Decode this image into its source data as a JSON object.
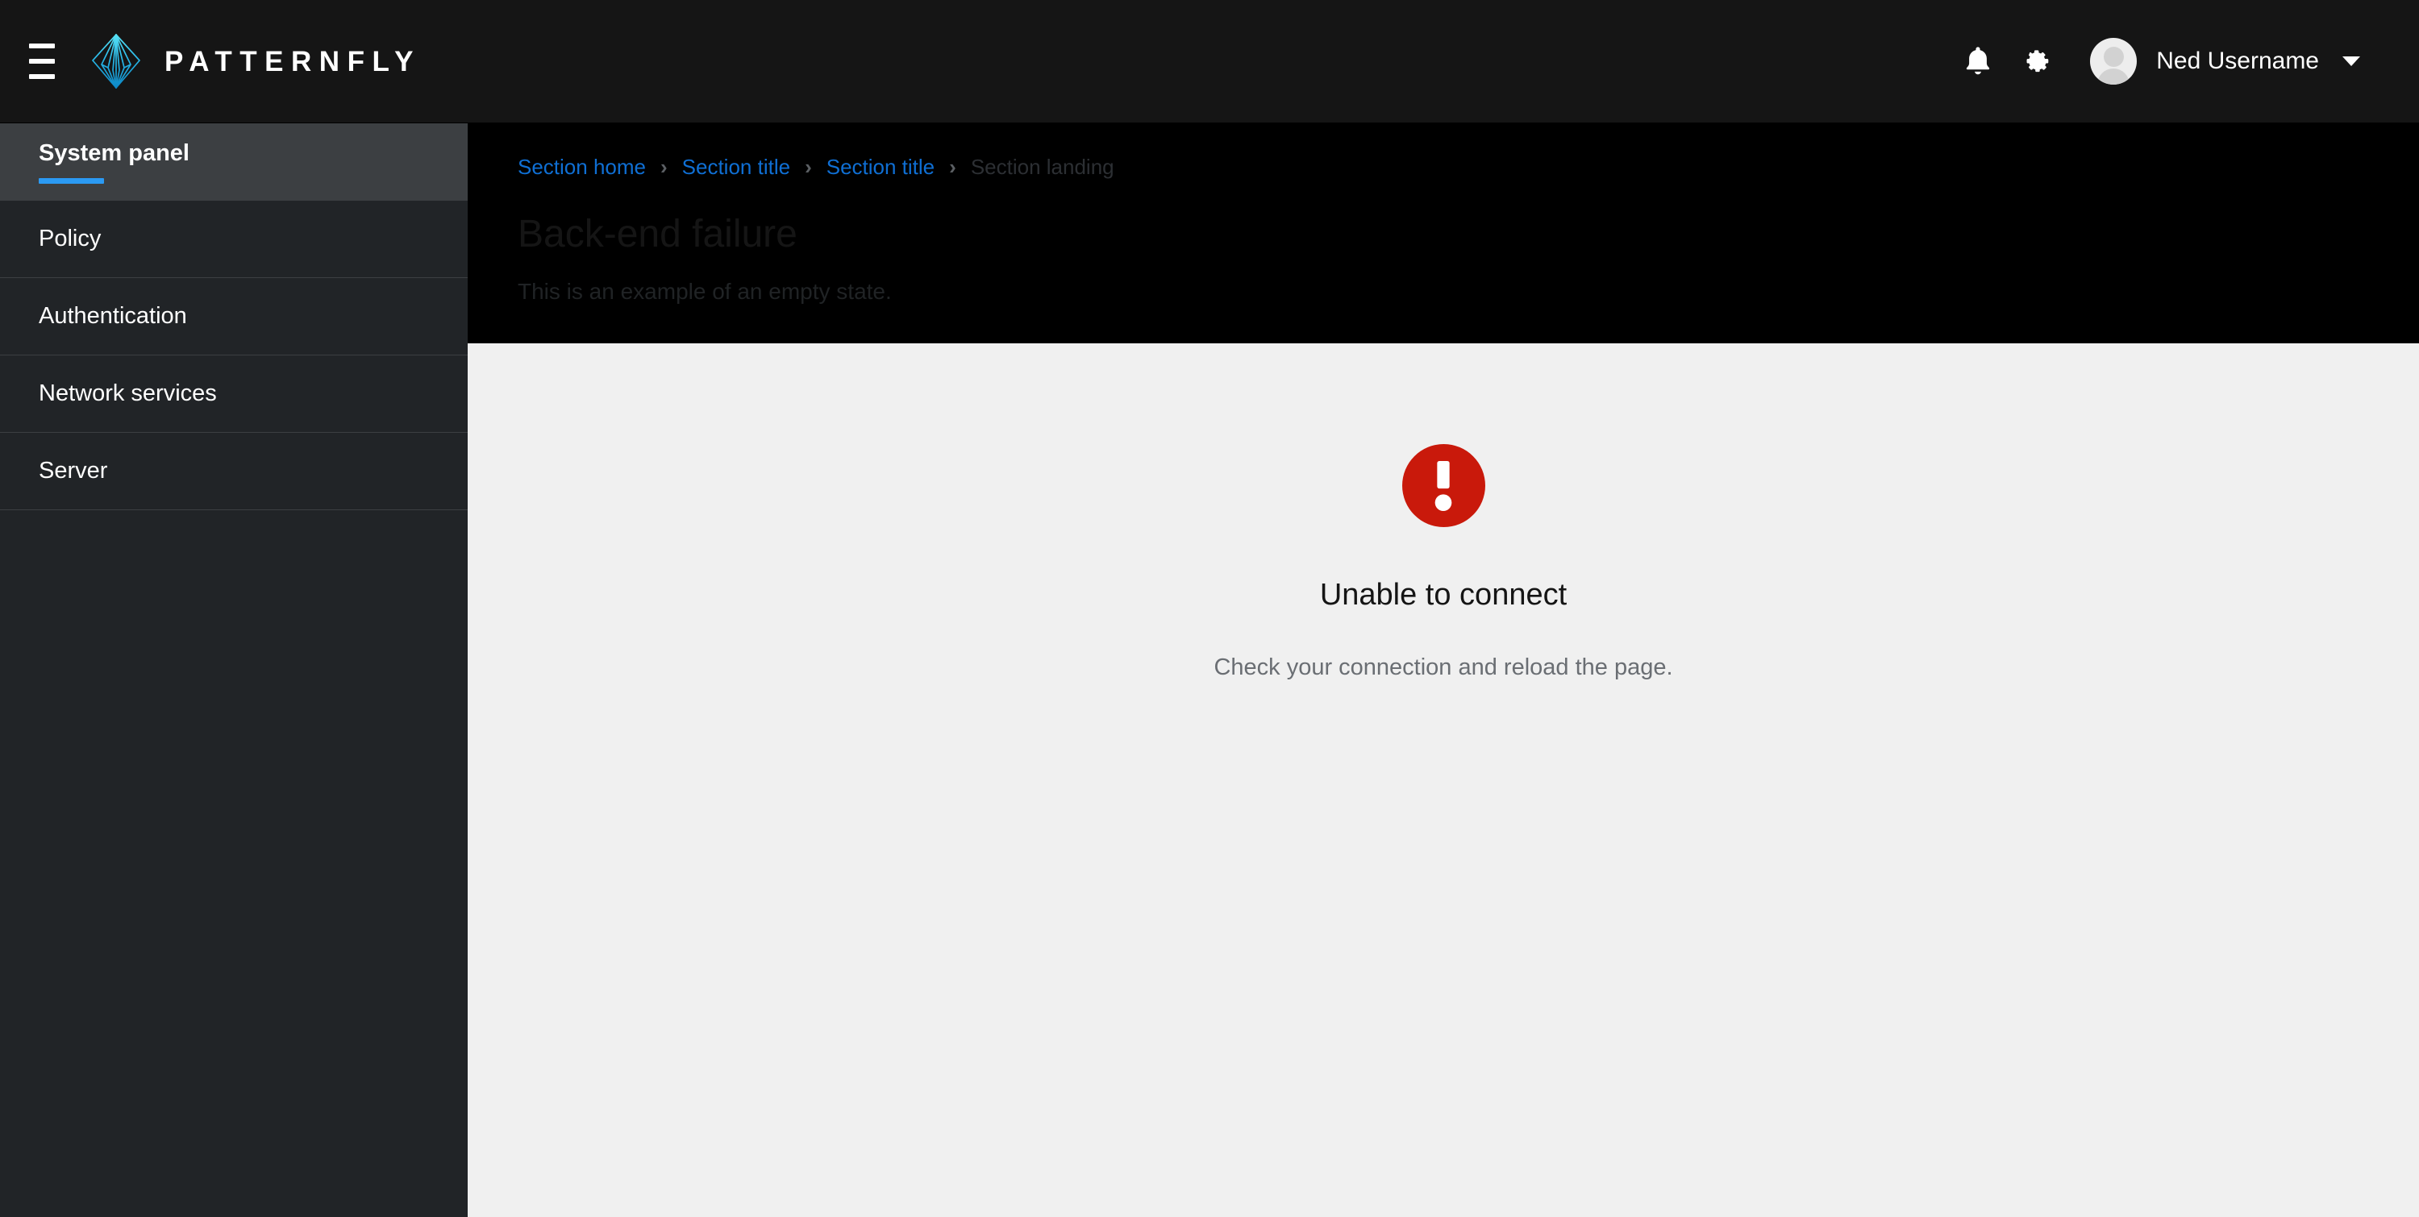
{
  "masthead": {
    "toggle_icon": "hamburger-icon",
    "brand_name": "PATTERNFLY",
    "brand_logo_icon": "patternfly-logo-icon",
    "notifications_icon": "bell-icon",
    "settings_icon": "gear-icon",
    "avatar_icon": "user-avatar-icon",
    "username": "Ned Username",
    "dropdown_icon": "caret-down-icon",
    "background_color": "#151515"
  },
  "sidebar": {
    "background_color": "#212427",
    "active_accent_color": "#2b9af3",
    "items": [
      {
        "label": "System panel",
        "active": true
      },
      {
        "label": "Policy",
        "active": false
      },
      {
        "label": "Authentication",
        "active": false
      },
      {
        "label": "Network services",
        "active": false
      },
      {
        "label": "Server",
        "active": false
      }
    ]
  },
  "page_header": {
    "background_color": "#000000",
    "breadcrumb": [
      {
        "label": "Section home",
        "current": false
      },
      {
        "label": "Section title",
        "current": false
      },
      {
        "label": "Section title",
        "current": false
      },
      {
        "label": "Section landing",
        "current": true
      }
    ],
    "breadcrumb_separator": "›",
    "title": "Back-end failure",
    "subtitle": "This is an example of an empty state."
  },
  "empty_state": {
    "icon": "exclamation-circle-icon",
    "icon_color": "#c9190b",
    "title": "Unable to connect",
    "body": "Check your connection and reload the page.",
    "background_color": "#f0f0f0"
  }
}
